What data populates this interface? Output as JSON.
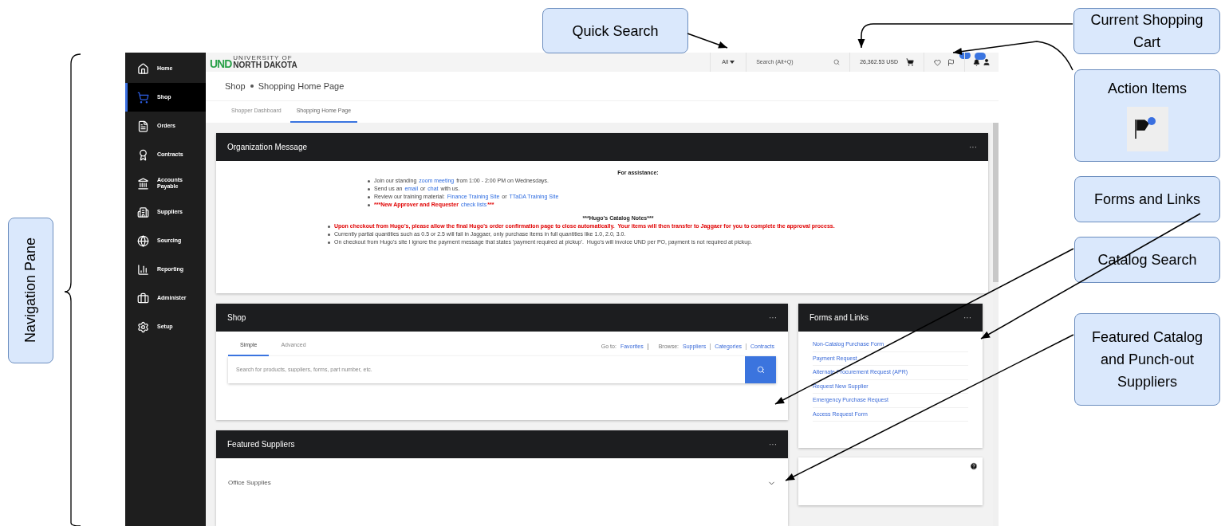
{
  "header": {
    "logo_mark": "UND",
    "logo_small": "UNIVERSITY OF",
    "logo_name": "NORTH DAKOTA",
    "scope": "All",
    "search_placeholder": "Search (Alt+Q)",
    "cart_total": "26,362.53 USD"
  },
  "nav": {
    "items": [
      {
        "label": "Home",
        "selected": false
      },
      {
        "label": "Shop",
        "selected": true
      },
      {
        "label": "Orders",
        "selected": false
      },
      {
        "label": "Contracts",
        "selected": false
      },
      {
        "label": "Accounts Payable",
        "selected": false
      },
      {
        "label": "Suppliers",
        "selected": false
      },
      {
        "label": "Sourcing",
        "selected": false
      },
      {
        "label": "Reporting",
        "selected": false
      },
      {
        "label": "Administer",
        "selected": false
      },
      {
        "label": "Setup",
        "selected": false
      }
    ]
  },
  "breadcrumb": [
    "Shop",
    "Shopping Home Page"
  ],
  "page_tabs": [
    {
      "label": "Shopper Dashboard",
      "selected": false
    },
    {
      "label": "Shopping Home Page",
      "selected": true
    }
  ],
  "org_message": {
    "title": "Organization Message",
    "menu": "···",
    "heading": "For assistance:",
    "items": [
      {
        "alert": false,
        "parts": [
          {
            "kind": "text",
            "text": "Join our standing "
          },
          {
            "kind": "link",
            "text": "zoom meeting"
          },
          {
            "kind": "text",
            "text": " from 1:00 - 2:00 PM on Wednesdays."
          }
        ]
      },
      {
        "alert": false,
        "parts": [
          {
            "kind": "text",
            "text": "Send us an "
          },
          {
            "kind": "link",
            "text": "email"
          },
          {
            "kind": "text",
            "text": " or "
          },
          {
            "kind": "link",
            "text": "chat"
          },
          {
            "kind": "text",
            "text": " with us."
          }
        ]
      },
      {
        "alert": false,
        "parts": [
          {
            "kind": "text",
            "text": "Review our training material: "
          },
          {
            "kind": "link",
            "text": "Finance Training Site"
          },
          {
            "kind": "text",
            "text": " or "
          },
          {
            "kind": "link",
            "text": "TTaDA Training Site"
          }
        ]
      },
      {
        "alert": true,
        "parts": [
          {
            "kind": "text",
            "text": "***New Approver and Requester "
          },
          {
            "kind": "link",
            "text": "check lists"
          },
          {
            "kind": "text",
            "text": "***"
          }
        ]
      }
    ],
    "notes_heading": "***Hugo's Catalog Notes***",
    "notes": [
      {
        "alert": true,
        "parts": [
          {
            "kind": "text",
            "text": "Upon checkout from Hugo's, please allow the final Hugo's order confirmation page to close automatically.  Your items will then transfer to Jaggaer for you to complete the approval process."
          }
        ]
      },
      {
        "alert": false,
        "parts": [
          {
            "kind": "text",
            "text": "Currently partial quantities such as 0.5 or 2.5 will fail in Jaggaer, only purchase items in full quantities like 1.0, 2.0, 3.0."
          }
        ]
      },
      {
        "alert": false,
        "parts": [
          {
            "kind": "text",
            "text": "On checkout from Hugo's site I ignore the payment message that states 'payment required at pickup'.  Hugo's will invoice UND per PO, payment is not required at pickup."
          }
        ]
      }
    ]
  },
  "shop": {
    "title": "Shop",
    "menu": "···",
    "tabs": [
      {
        "label": "Simple",
        "selected": true
      },
      {
        "label": "Advanced",
        "selected": false
      }
    ],
    "goto_label": "Go to:",
    "goto_links": [
      "Favorites"
    ],
    "browse_label": "Browse:",
    "browse_links": [
      "Suppliers",
      "Categories",
      "Contracts"
    ],
    "search_placeholder": "Search for products, suppliers, forms, part number, etc."
  },
  "featured": {
    "title": "Featured Suppliers",
    "menu": "···",
    "sections": [
      {
        "label": "Office Supplies",
        "expanded": false
      }
    ]
  },
  "forms": {
    "title": "Forms and Links",
    "menu": "···",
    "links": [
      "Non-Catalog Purchase Form",
      "Payment Request",
      "Alternate Procurement Request (APR)",
      "Request New Supplier",
      "Emergency Purchase Request",
      "Access Request Form"
    ]
  },
  "callouts": [
    {
      "text": "Quick Search"
    },
    {
      "text": "Current Shopping Cart"
    },
    {
      "text": "Action Items"
    },
    {
      "text": "Forms and Links"
    },
    {
      "text": "Catalog Search"
    },
    {
      "text": "Featured Catalog and Punch-out Suppliers"
    },
    {
      "text": "Navigation Pane"
    }
  ]
}
